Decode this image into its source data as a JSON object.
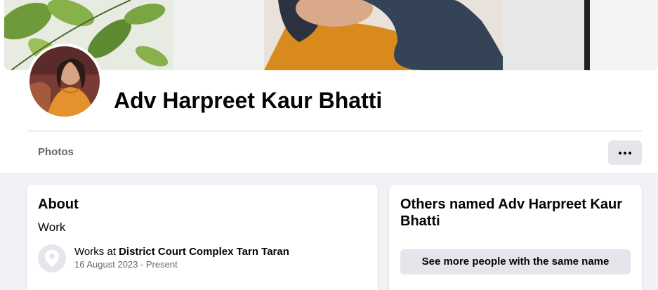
{
  "profile": {
    "name": "Adv Harpreet Kaur Bhatti",
    "cover_icon": "cover-photo",
    "avatar_icon": "profile-avatar"
  },
  "tabs": [
    {
      "label": "Photos"
    }
  ],
  "actions": {
    "more_icon": "ellipsis-icon"
  },
  "about": {
    "title": "About",
    "section": "Work",
    "work": {
      "prefix": "Works at ",
      "employer": "District Court Complex Tarn Taran",
      "dates": "16 August 2023 - Present",
      "icon": "location-pin-icon"
    }
  },
  "others": {
    "title": "Others named Adv Harpreet Kaur Bhatti",
    "button_label": "See more people with the same name"
  },
  "colors": {
    "page_bg": "#f0f2f5",
    "card_bg": "#ffffff",
    "button_bg": "#e4e6eb",
    "secondary_text": "#65676b",
    "primary_text": "#050505"
  }
}
